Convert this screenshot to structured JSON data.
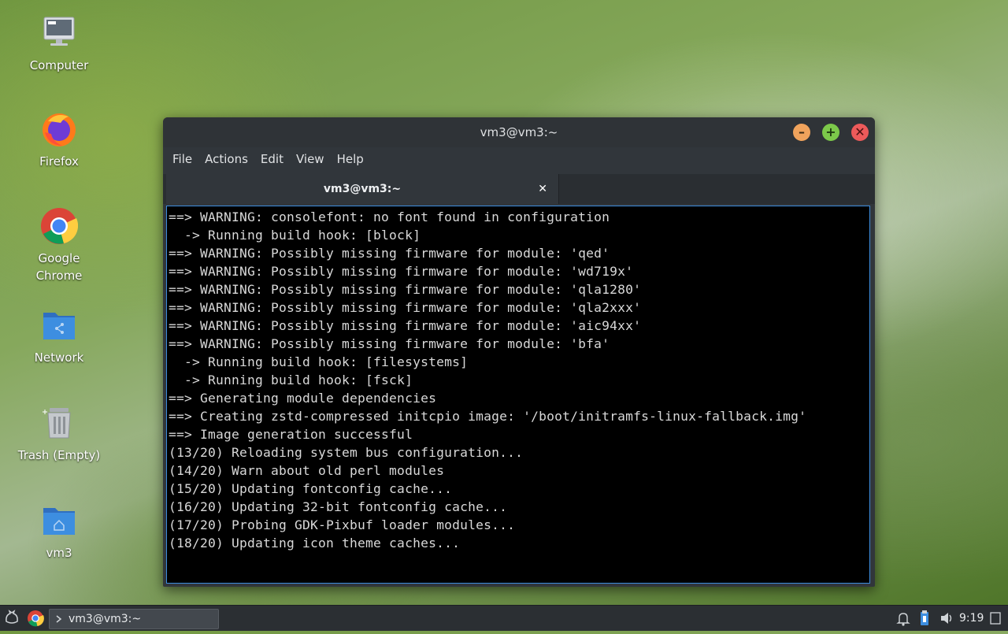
{
  "desktop": {
    "icons": [
      {
        "label": "Computer",
        "icon": "computer-icon"
      },
      {
        "label": "Firefox",
        "icon": "firefox-icon"
      },
      {
        "label": "Google\nChrome",
        "icon": "chrome-icon"
      },
      {
        "label": "Network",
        "icon": "network-folder-icon"
      },
      {
        "label": "Trash (Empty)",
        "icon": "trash-icon"
      },
      {
        "label": "vm3",
        "icon": "home-folder-icon"
      }
    ]
  },
  "window": {
    "title": "vm3@vm3:~",
    "buttons": {
      "minimize": "–",
      "maximize": "+",
      "close": "✕"
    },
    "menu": [
      "File",
      "Actions",
      "Edit",
      "View",
      "Help"
    ],
    "tab": {
      "title": "vm3@vm3:~",
      "close": "✕"
    },
    "terminal_lines": [
      "==> WARNING: consolefont: no font found in configuration",
      "  -> Running build hook: [block]",
      "==> WARNING: Possibly missing firmware for module: 'qed'",
      "==> WARNING: Possibly missing firmware for module: 'wd719x'",
      "==> WARNING: Possibly missing firmware for module: 'qla1280'",
      "==> WARNING: Possibly missing firmware for module: 'qla2xxx'",
      "==> WARNING: Possibly missing firmware for module: 'aic94xx'",
      "==> WARNING: Possibly missing firmware for module: 'bfa'",
      "  -> Running build hook: [filesystems]",
      "  -> Running build hook: [fsck]",
      "==> Generating module dependencies",
      "==> Creating zstd-compressed initcpio image: '/boot/initramfs-linux-fallback.img'",
      "==> Image generation successful",
      "(13/20) Reloading system bus configuration...",
      "(14/20) Warn about old perl modules",
      "(15/20) Updating fontconfig cache...",
      "(16/20) Updating 32-bit fontconfig cache...",
      "(17/20) Probing GDK-Pixbuf loader modules...",
      "(18/20) Updating icon theme caches..."
    ]
  },
  "taskbar": {
    "task_label": "vm3@vm3:~",
    "clock": "9:19",
    "tray": [
      "notification-bell-icon",
      "usb-icon",
      "volume-icon",
      "clock",
      "show-desktop-icon"
    ]
  },
  "colors": {
    "accent": "#3d8ee0",
    "minimize": "#f0a35c",
    "maximize": "#7cc94a",
    "close": "#ed5a5a"
  }
}
